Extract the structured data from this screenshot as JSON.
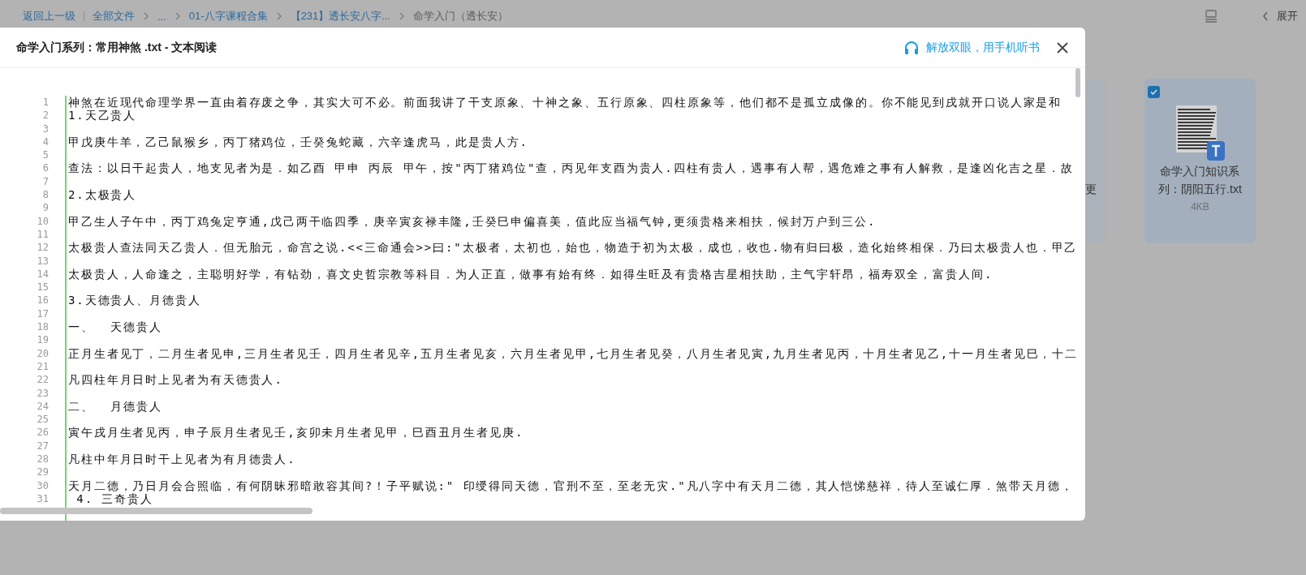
{
  "breadcrumb": [
    {
      "label": "返回上一级",
      "kind": "back"
    },
    {
      "label": "全部文件",
      "kind": "link"
    },
    {
      "label": "...",
      "kind": "link"
    },
    {
      "label": "01-八字课程合集",
      "kind": "link"
    },
    {
      "label": "【231】透长安八字...",
      "kind": "link"
    },
    {
      "label": "命学入门（透长安）",
      "kind": "current"
    }
  ],
  "toolbar": {
    "expand_label": "展开"
  },
  "files": [
    {
      "name_lines": [
        "更"
      ],
      "partial": true
    },
    {
      "name_lines": [
        "命学入门知识系",
        "列：阴阳五行.txt"
      ],
      "size": "4KB",
      "selected": true,
      "partial": false
    }
  ],
  "dialog": {
    "title": "命学入门系列：常用神煞 .txt - 文本阅读",
    "listen_link": "解放双眼，用手机听书",
    "lines": [
      {
        "number": "1",
        "text": "神煞在近现代命理学界一直由着存废之争，其实大可不必。前面我讲了干支原象、十神之象、五行原象、四柱原象等，他们都不是孤立成像的。你不能见到戌就开口说人家是和"
      },
      {
        "number": "2",
        "text": "1.天乙贵人"
      },
      {
        "number": "3"
      },
      {
        "number": "4",
        "text": "甲戊庚牛羊，乙己鼠猴乡，丙丁猪鸡位，壬癸兔蛇藏，六辛逢虎马，此是贵人方."
      },
      {
        "number": "5"
      },
      {
        "number": "6",
        "text": "查法：以日干起贵人，地支见者为是．如乙酉 甲申 丙辰 甲午，按\"丙丁猪鸡位\"查，丙见年支酉为贵人.四柱有贵人，遇事有人帮，遇危难之事有人解救，是逢凶化吉之星．故"
      },
      {
        "number": "7"
      },
      {
        "number": "8",
        "text": "2.太极贵人"
      },
      {
        "number": "9"
      },
      {
        "number": "10",
        "text": "甲乙生人子午中，丙丁鸡兔定亨通,戊己两干临四季，庚辛寅亥禄丰隆,壬癸巳申偏喜美，值此应当福气钟,更须贵格来相扶，候封万户到三公."
      },
      {
        "number": "11"
      },
      {
        "number": "12",
        "text": "太极贵人查法同天乙贵人．但无胎元，命宫之说.<<三命通会>>曰:\"太极者，太初也，始也，物造于初为太极，成也，收也.物有归曰极，造化始终相保．乃曰太极贵人也．甲乙"
      },
      {
        "number": "13"
      },
      {
        "number": "14",
        "text": "太极贵人，人命逢之，主聪明好学，有钻劲，喜文史哲宗教等科目．为人正直，做事有始有终．如得生旺及有贵格吉星相扶助，主气宇轩昂，福寿双全，富贵人间."
      },
      {
        "number": "15"
      },
      {
        "number": "16",
        "text": "3.天德贵人、月德贵人"
      },
      {
        "number": "17"
      },
      {
        "number": "18",
        "text": "一、  天德贵人"
      },
      {
        "number": "19"
      },
      {
        "number": "20",
        "text": "正月生者见丁，二月生者见申,三月生者见壬，四月生者见辛,五月生者见亥，六月生者见甲,七月生者见癸，八月生者见寅,九月生者见丙，十月生者见乙,十一月生者见巳，十二"
      },
      {
        "number": "21"
      },
      {
        "number": "22",
        "text": "凡四柱年月日时上见者为有天德贵人."
      },
      {
        "number": "23"
      },
      {
        "number": "24",
        "text": "二、  月德贵人"
      },
      {
        "number": "25"
      },
      {
        "number": "26",
        "text": "寅午戌月生者见丙，申子辰月生者见壬,亥卯未月生者见甲，巳酉丑月生者见庚."
      },
      {
        "number": "27"
      },
      {
        "number": "28",
        "text": "凡柱中年月日时干上见者为有月德贵人."
      },
      {
        "number": "29"
      },
      {
        "number": "30",
        "text": "天月二德，乃日月会合照临，有何阴昧邪暗敢容其间?！子平赋说:\" 印绶得同天德，官刑不至，至老无灾.\"凡八字中有天月二德，其人恺悌慈祥，待人至诚仁厚．煞带天月德，"
      },
      {
        "number": "31",
        "text": " 4. 三奇贵人"
      }
    ]
  }
}
